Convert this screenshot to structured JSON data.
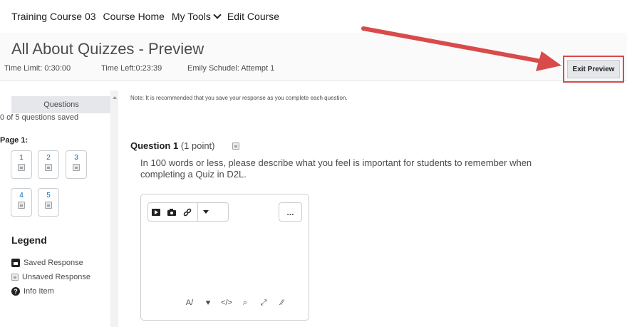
{
  "nav": {
    "course": "Training Course 03",
    "course_home": "Course Home",
    "my_tools": "My Tools",
    "edit_course": "Edit Course"
  },
  "header": {
    "title": "All About Quizzes - Preview",
    "time_limit": "Time Limit: 0:30:00",
    "time_left": "Time Left:0:23:39",
    "attempt": "Emily Schudel: Attempt 1",
    "exit_preview": "Exit Preview"
  },
  "sidebar": {
    "tab": "Questions",
    "saved_count": "0 of 5 questions saved",
    "page_label": "Page 1:",
    "questions": [
      "1",
      "2",
      "3",
      "4",
      "5"
    ],
    "legend_title": "Legend",
    "legend": {
      "saved": "Saved Response",
      "unsaved": "Unsaved Response",
      "info": "Info Item"
    }
  },
  "main": {
    "note": "Note: It is recommended that you save your response as you complete each question.",
    "question_label": "Question 1",
    "question_points": "(1 point)",
    "question_text": "In 100 words or less, please describe what you feel is important for students to remember when completing a Quiz in D2L.",
    "more_label": "..."
  },
  "colors": {
    "arrow": "#d94a4a",
    "link": "#006fbf",
    "header_bg": "#fafafa"
  }
}
